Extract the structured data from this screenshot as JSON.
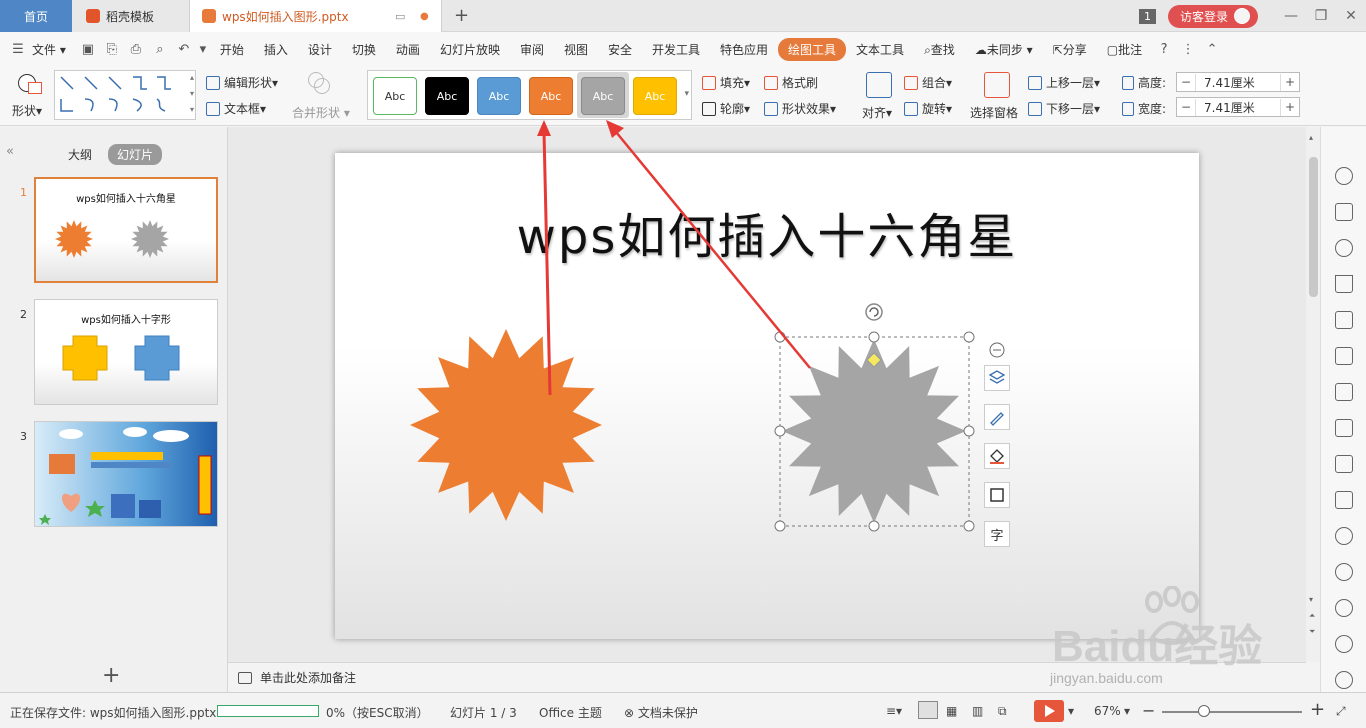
{
  "tabbar": {
    "home_label": "首页",
    "docer_label": "稻壳模板",
    "doc_label": "wps如何插入图形.pptx",
    "add_icon": "plus-icon",
    "page_count": "1",
    "login_label": "访客登录"
  },
  "menubar": {
    "file_label": "文件",
    "items": [
      "开始",
      "插入",
      "设计",
      "切换",
      "动画",
      "幻灯片放映",
      "审阅",
      "视图",
      "安全",
      "开发工具",
      "特色应用",
      "绘图工具",
      "文本工具"
    ],
    "active_item": "绘图工具",
    "search_label": "查找",
    "sync_label": "未同步",
    "share_label": "分享",
    "comment_label": "批注"
  },
  "ribbon": {
    "shape_label": "形状",
    "edit_shape_label": "编辑形状",
    "textbox_label": "文本框",
    "merge_shape_label": "合并形状",
    "style_swatches": [
      {
        "label": "Abc",
        "bg": "#ffffff",
        "fg": "#333333",
        "border": "#5cb85c"
      },
      {
        "label": "Abc",
        "bg": "#000000",
        "fg": "#ffffff",
        "border": "#000000"
      },
      {
        "label": "Abc",
        "bg": "#5b9bd5",
        "fg": "#ffffff",
        "border": "#4a86c0"
      },
      {
        "label": "Abc",
        "bg": "#ed7d31",
        "fg": "#ffffff",
        "border": "#d0651c"
      },
      {
        "label": "Abc",
        "bg": "#a5a5a5",
        "fg": "#ffffff",
        "border": "#8a8a8a"
      },
      {
        "label": "Abc",
        "bg": "#ffc000",
        "fg": "#ffffff",
        "border": "#e0a800"
      }
    ],
    "fill_label": "填充",
    "outline_label": "轮廓",
    "format_painter_label": "格式刷",
    "shape_effect_label": "形状效果",
    "align_label": "对齐",
    "group_label": "组合",
    "rotate_label": "旋转",
    "selection_pane_label": "选择窗格",
    "bring_forward_label": "上移一层",
    "send_backward_label": "下移一层",
    "height_label": "高度:",
    "width_label": "宽度:",
    "height_value": "7.41厘米",
    "width_value": "7.41厘米"
  },
  "left_panel": {
    "outline_tab": "大纲",
    "slides_tab": "幻灯片",
    "slides": [
      {
        "number": "1",
        "title": "wps如何插入十六角星"
      },
      {
        "number": "2",
        "title": "wps如何插入十字形"
      },
      {
        "number": "3",
        "title": ""
      }
    ]
  },
  "slide": {
    "title": "wps如何插入十六角星",
    "star_left_color": "#ed7d31",
    "star_right_color": "#a5a5a5"
  },
  "notes": {
    "placeholder": "单击此处添加备注"
  },
  "statusbar": {
    "saving_label": "正在保存文件: wps如何插入图形.pptx",
    "progress_text": "0%（按ESC取消）",
    "progress_percent": 0,
    "slide_info": "幻灯片 1 / 3",
    "theme": "Office 主题",
    "protect": "文档未保护",
    "zoom": "67%",
    "zoom_fraction": 0.3
  },
  "watermark": {
    "brand": "Baidu经验",
    "url": "jingyan.baidu.com"
  },
  "colors": {
    "accent_orange": "#e67a3a",
    "arrow_red": "#e53935",
    "tab_blue": "#4f86c6"
  }
}
